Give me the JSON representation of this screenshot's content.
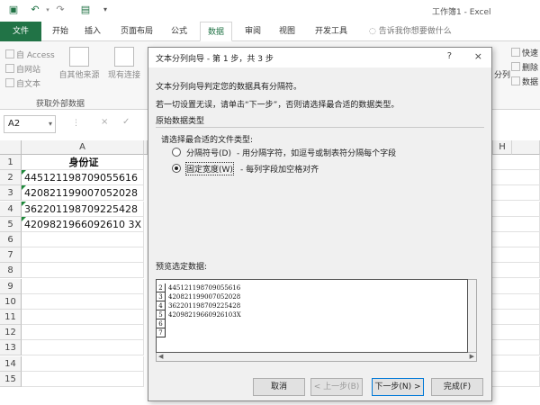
{
  "window": {
    "title": "工作簿1 - Excel"
  },
  "quick_access": {
    "icons": [
      "save-icon",
      "undo-icon",
      "redo-icon",
      "print-preview-icon",
      "customize-icon"
    ]
  },
  "ribbon": {
    "tabs": [
      {
        "label": "文件"
      },
      {
        "label": "开始"
      },
      {
        "label": "插入"
      },
      {
        "label": "页面布局"
      },
      {
        "label": "公式"
      },
      {
        "label": "数据"
      },
      {
        "label": "审阅"
      },
      {
        "label": "视图"
      },
      {
        "label": "开发工具"
      }
    ],
    "active_tab": "数据",
    "tell_me": "告诉我你想要做什么",
    "get_external": {
      "access": "自 Access",
      "web": "自网站",
      "text": "自文本",
      "other": "自其他来源",
      "existing": "现有连接",
      "group_label": "获取外部数据"
    },
    "right_items": {
      "quick": "快速",
      "delete": "删除",
      "data": "数据",
      "split": "分列"
    }
  },
  "formula_bar": {
    "name_box": "A2",
    "cancel": "×",
    "enter": "✓"
  },
  "sheet": {
    "columns": [
      "A",
      "H"
    ],
    "rows": [
      "1",
      "2",
      "3",
      "4",
      "5",
      "6",
      "7",
      "8",
      "9",
      "10",
      "11",
      "12",
      "13",
      "14",
      "15"
    ],
    "cells": [
      "身份证",
      "445121198709055616",
      "420821199007052028",
      "362201198709225428",
      "4209821966092610 3X"
    ]
  },
  "dialog": {
    "title": "文本分列向导 - 第 1 步，共 3 步",
    "help": "?",
    "close": "×",
    "intro1": "文本分列向导判定您的数据具有分隔符。",
    "intro2": "若一切设置无误，请单击“下一步”，否则请选择最合适的数据类型。",
    "section_title": "原始数据类型",
    "choose_label": "请选择最合适的文件类型:",
    "options": [
      {
        "label": "分隔符号(D)",
        "desc": "- 用分隔字符，如逗号或制表符分隔每个字段",
        "selected": false
      },
      {
        "label": "固定宽度(W)",
        "desc": "- 每列字段加空格对齐",
        "selected": true
      }
    ],
    "preview_label": "预览选定数据:",
    "preview_rows": [
      {
        "num": "2",
        "val": "445121198709055616"
      },
      {
        "num": "3",
        "val": "420821199007052028"
      },
      {
        "num": "4",
        "val": "362201198709225428"
      },
      {
        "num": "5",
        "val": "42098219660926103X"
      },
      {
        "num": "6",
        "val": ""
      },
      {
        "num": "7",
        "val": ""
      }
    ],
    "buttons": {
      "cancel": "取消",
      "back": "< 上一步(B)",
      "next": "下一步(N) >",
      "finish": "完成(F)"
    }
  }
}
